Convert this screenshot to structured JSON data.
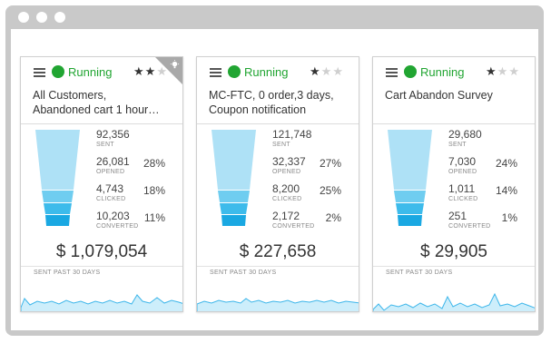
{
  "colors": {
    "running": "#21a532",
    "funnel_sent": "#aee1f6",
    "funnel_opened": "#6fcdf0",
    "funnel_clicked": "#3dbbeb",
    "funnel_converted": "#1aa8e2",
    "sparkline": "#3db6ea"
  },
  "icons": [
    "menu-icon",
    "star-icon",
    "lightbulb-icon"
  ],
  "cards": [
    {
      "status": "Running",
      "rating": 2,
      "max_rating": 3,
      "has_badge": true,
      "title_line1": "All Customers,",
      "title_line2": "Abandoned cart 1 hour…",
      "stats": [
        {
          "value": "92,356",
          "label": "SENT",
          "pct": ""
        },
        {
          "value": "26,081",
          "label": "OPENED",
          "pct": "28%"
        },
        {
          "value": "4,743",
          "label": "CLICKED",
          "pct": "18%"
        },
        {
          "value": "10,203",
          "label": "CONVERTED",
          "pct": "11%"
        }
      ],
      "total": "$ 1,079,054",
      "sent_label": "SENT PAST 30 DAYS"
    },
    {
      "status": "Running",
      "rating": 1,
      "max_rating": 3,
      "has_badge": false,
      "title_line1": "MC-FTC, 0 order,3 days,",
      "title_line2": "Coupon notification",
      "stats": [
        {
          "value": "121,748",
          "label": "SENT",
          "pct": ""
        },
        {
          "value": "32,337",
          "label": "OPENED",
          "pct": "27%"
        },
        {
          "value": "8,200",
          "label": "CLICKED",
          "pct": "25%"
        },
        {
          "value": "2,172",
          "label": "CONVERTED",
          "pct": "2%"
        }
      ],
      "total": "$ 227,658",
      "sent_label": "SENT PAST 30 DAYS"
    },
    {
      "status": "Running",
      "rating": 1,
      "max_rating": 3,
      "has_badge": false,
      "title_line1": "Cart Abandon Survey",
      "title_line2": "",
      "stats": [
        {
          "value": "29,680",
          "label": "SENT",
          "pct": ""
        },
        {
          "value": "7,030",
          "label": "OPENED",
          "pct": "24%"
        },
        {
          "value": "1,011",
          "label": "CLICKED",
          "pct": "14%"
        },
        {
          "value": "251",
          "label": "CONVERTED",
          "pct": "1%"
        }
      ],
      "total": "$ 29,905",
      "sent_label": "SENT PAST 30 DAYS"
    }
  ]
}
